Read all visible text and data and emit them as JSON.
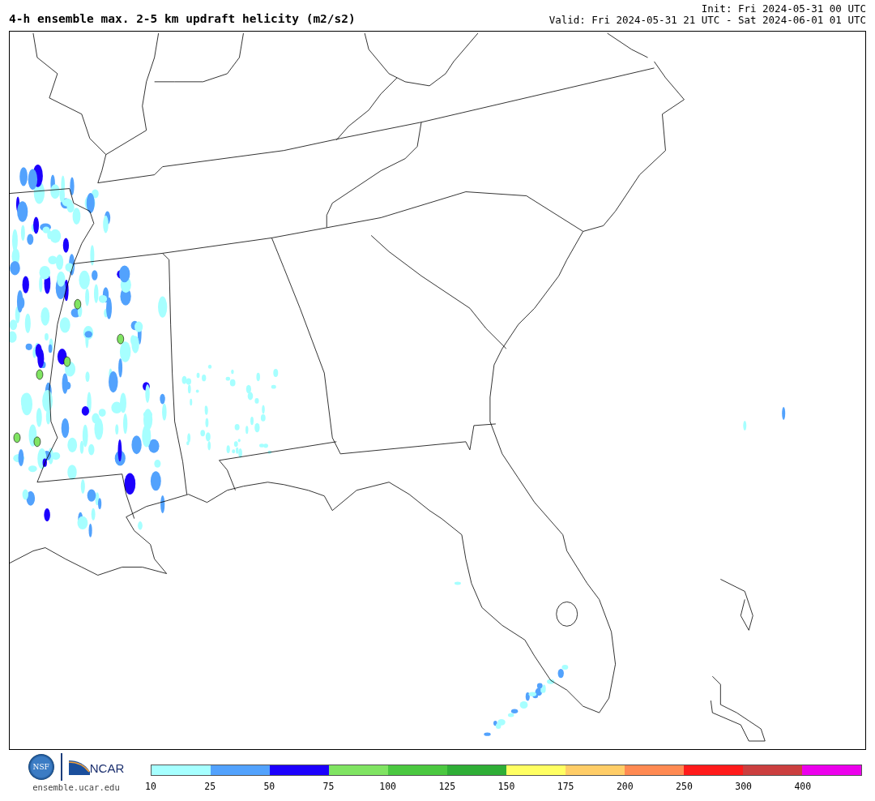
{
  "title": "4-h ensemble max. 2-5 km updraft helicity (m2/s2)",
  "init": "Init: Fri 2024-05-31 00 UTC",
  "valid": "Valid: Fri 2024-05-31 21 UTC - Sat 2024-06-01 01 UTC",
  "logos": {
    "nsf": "NSF",
    "ncar": "NCAR"
  },
  "site": "ensemble.ucar.edu",
  "colorbar": [
    {
      "label": "10",
      "color": "#a6ffff"
    },
    {
      "label": "25",
      "color": "#52a2fd"
    },
    {
      "label": "50",
      "color": "#1c00fd"
    },
    {
      "label": "75",
      "color": "#80e462"
    },
    {
      "label": "100",
      "color": "#4bc840"
    },
    {
      "label": "125",
      "color": "#2fae36"
    },
    {
      "label": "150",
      "color": "#ffff62"
    },
    {
      "label": "175",
      "color": "#ffcd67"
    },
    {
      "label": "200",
      "color": "#ff8a52"
    },
    {
      "label": "250",
      "color": "#ff1b1b"
    },
    {
      "label": "300",
      "color": "#cb3f3f"
    },
    {
      "label": "400",
      "color": "#ec00ec"
    }
  ]
}
